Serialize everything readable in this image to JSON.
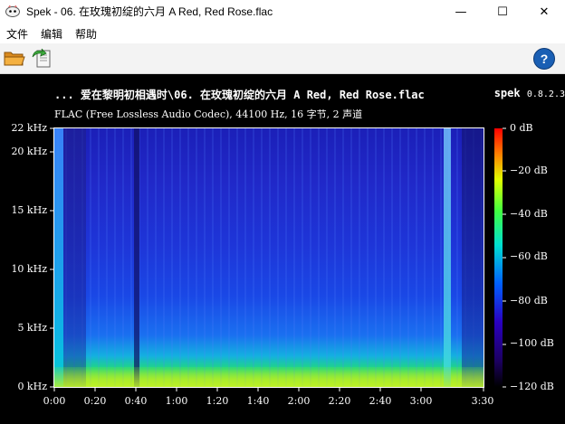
{
  "window": {
    "title": "Spek - 06. 在玫瑰初绽的六月   A Red, Red Rose.flac",
    "minimize_glyph": "—",
    "maximize_glyph": "☐",
    "close_glyph": "✕"
  },
  "menu": {
    "items": [
      "文件",
      "编辑",
      "帮助"
    ]
  },
  "toolbar": {
    "icons": [
      "open-folder-icon",
      "save-icon",
      "help-icon"
    ],
    "help_label": "?"
  },
  "spectrogram": {
    "file_line": "... 爱在黎明初相遇时\\06. 在玫瑰初绽的六月  A Red, Red Rose.flac",
    "app_name": "spek",
    "version": "0.8.2.3",
    "info_line": "FLAC (Free Lossless Audio Codec), 44100 Hz, 16 字节, 2 声道",
    "freq_labels": [
      "22 kHz",
      "20 kHz",
      "15 kHz",
      "10 kHz",
      "5 kHz",
      "0 kHz"
    ],
    "time_labels": [
      "0:00",
      "0:20",
      "0:40",
      "1:00",
      "1:20",
      "1:40",
      "2:00",
      "2:20",
      "2:40",
      "3:00",
      "3:30"
    ],
    "db_labels": [
      "0 dB",
      "−20 dB",
      "−40 dB",
      "−60 dB",
      "−80 dB",
      "−100 dB",
      "−120 dB"
    ],
    "colors": {
      "background": "#000000",
      "text": "#ffffff",
      "grid_low": "#00008c",
      "grid_high": "#ff0000"
    }
  }
}
